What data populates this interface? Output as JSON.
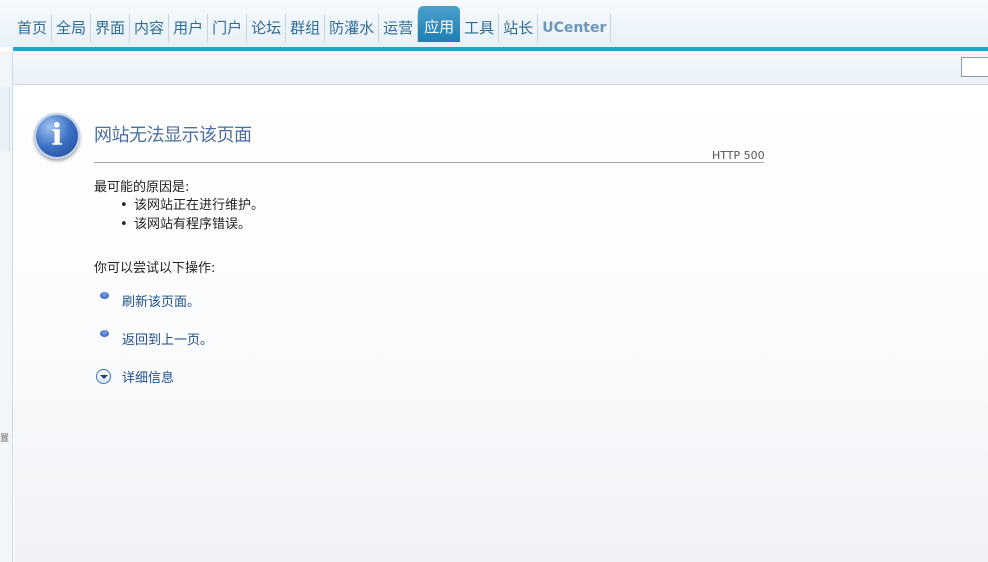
{
  "nav": {
    "items": [
      "首页",
      "全局",
      "界面",
      "内容",
      "用户",
      "门户",
      "论坛",
      "群组",
      "防灌水",
      "运营",
      "应用",
      "工具",
      "站长",
      "UCenter"
    ],
    "active": "应用"
  },
  "sidebar": {
    "glyph": "置"
  },
  "error": {
    "title": "网站无法显示该页面",
    "code": "HTTP 500",
    "reasons_heading": "最可能的原因是:",
    "reasons": [
      "该网站正在进行维护。",
      "该网站有程序错误。"
    ],
    "actions_heading": "你可以尝试以下操作:",
    "actions": [
      "刷新该页面。",
      "返回到上一页。"
    ],
    "details_label": "详细信息"
  },
  "colors": {
    "accent": "#27a2c8",
    "nav_text": "#2f6a93",
    "link": "#1f4f8c"
  },
  "icons": {
    "info": "info-icon",
    "action": "blue-bullet-icon",
    "details": "chevron-down-circle-icon"
  }
}
